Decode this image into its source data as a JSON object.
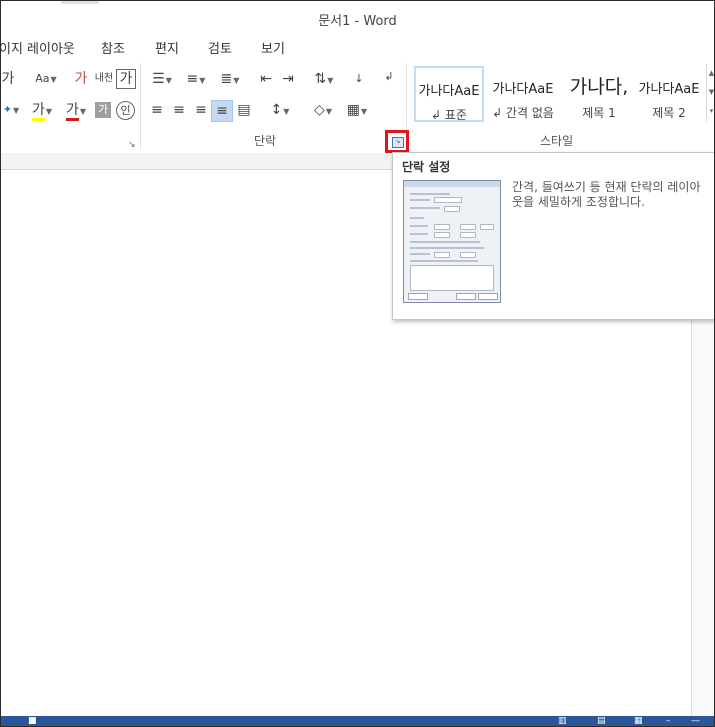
{
  "window": {
    "title": "문서1 - Word"
  },
  "tabs": [
    "이지 레이아웃",
    "참조",
    "편지",
    "검토",
    "보기"
  ],
  "font_group": {
    "buttons": [
      "가",
      "Aa",
      "가",
      "내천",
      "가",
      "가",
      "가",
      "가",
      "인"
    ]
  },
  "paragraph_group": {
    "label": "단락"
  },
  "styles_group": {
    "label": "스타일",
    "styles": [
      {
        "sample": "가나다AaE",
        "name": "↲ 표준"
      },
      {
        "sample": "가나다AaE",
        "name": "↲ 간격 없음"
      },
      {
        "sample": "가나다,",
        "name": "제목 1"
      },
      {
        "sample": "가나다AaE",
        "name": "제목 2"
      }
    ]
  },
  "tooltip": {
    "title": "단락 설정",
    "description": "간격, 들여쓰기 등 현재 단락의 레이아웃을 세밀하게 조정합니다."
  },
  "colors": {
    "highlight_box": "#e1131b",
    "statusbar": "#2b579a",
    "selected_button": "#c5d9f1"
  }
}
